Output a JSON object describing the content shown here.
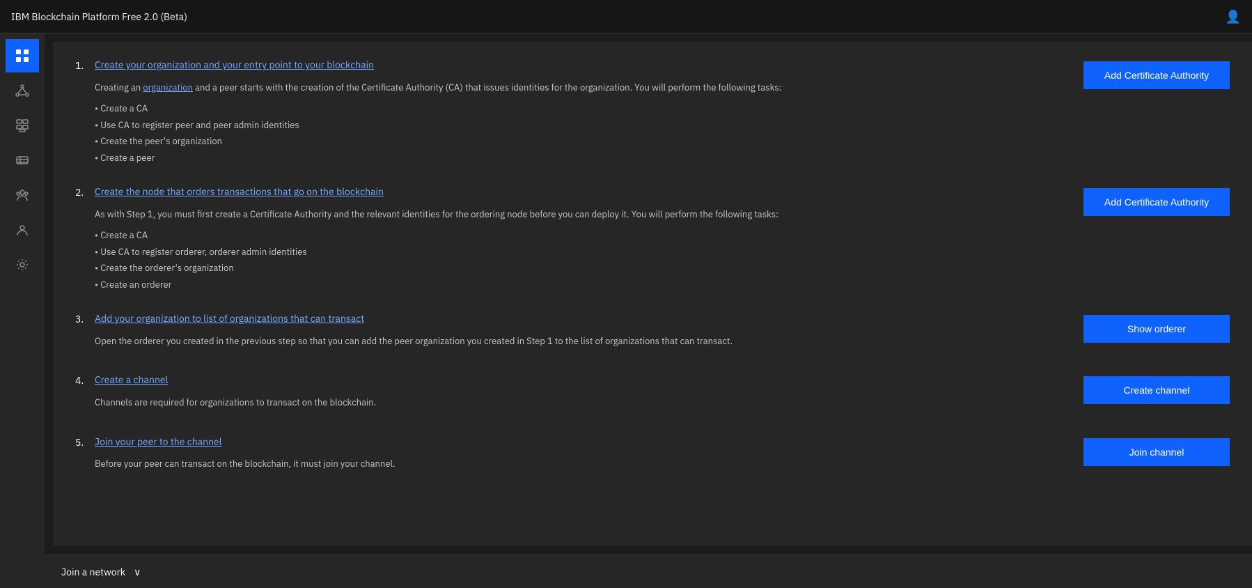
{
  "header": {
    "title": "IBM Blockchain Platform Free 2.0 (Beta)",
    "user_icon": "👤"
  },
  "sidebar": {
    "items": [
      {
        "id": "dashboard",
        "icon": "grid",
        "active": true
      },
      {
        "id": "network",
        "icon": "nodes",
        "active": false
      },
      {
        "id": "components",
        "icon": "components",
        "active": false
      },
      {
        "id": "channels",
        "icon": "channels",
        "active": false
      },
      {
        "id": "organizations",
        "icon": "organizations",
        "active": false
      },
      {
        "id": "identity",
        "icon": "identity",
        "active": false
      },
      {
        "id": "settings",
        "icon": "settings",
        "active": false
      }
    ]
  },
  "main": {
    "steps": [
      {
        "number": "1.",
        "title": "Create your organization and your entry point to your blockchain",
        "title_href": "#",
        "description_prefix": "Creating an ",
        "description_link_text": "organization",
        "description_link_href": "#",
        "description_suffix": " and a peer starts with the creation of the Certificate Authority (CA) that issues identities for the organization. You will perform the following tasks:",
        "bullets": [
          "• Create a CA",
          "• Use CA to register peer and peer admin identities",
          "• Create the peer's organization",
          "• Create a peer"
        ],
        "button_label": "Add Certificate Authority"
      },
      {
        "number": "2.",
        "title": "Create the node that orders transactions that go on the blockchain",
        "title_href": "#",
        "description": "As with Step 1, you must first create a Certificate Authority and the relevant identities for the ordering node before you can deploy it. You will perform the following tasks:",
        "bullets": [
          "• Create a CA",
          "• Use CA to register orderer, orderer admin identities",
          "• Create the orderer's organization",
          "• Create an orderer"
        ],
        "button_label": "Add Certificate Authority"
      },
      {
        "number": "3.",
        "title": "Add your organization to list of organizations that can transact",
        "title_href": "#",
        "description": "Open the orderer you created in the previous step so that you can add the peer organization you created in Step 1 to the list of organizations that can transact.",
        "bullets": [],
        "button_label": "Show orderer"
      },
      {
        "number": "4.",
        "title": "Create a channel",
        "title_href": "#",
        "description": "Channels are required for organizations to transact on the blockchain.",
        "bullets": [],
        "button_label": "Create channel"
      },
      {
        "number": "5.",
        "title": "Join your peer to the channel",
        "title_href": "#",
        "description": "Before your peer can transact on the blockchain, it must join your channel.",
        "bullets": [],
        "button_label": "Join channel"
      }
    ],
    "bottom_bar_label": "Join a network",
    "bottom_bar_chevron": "∨"
  }
}
